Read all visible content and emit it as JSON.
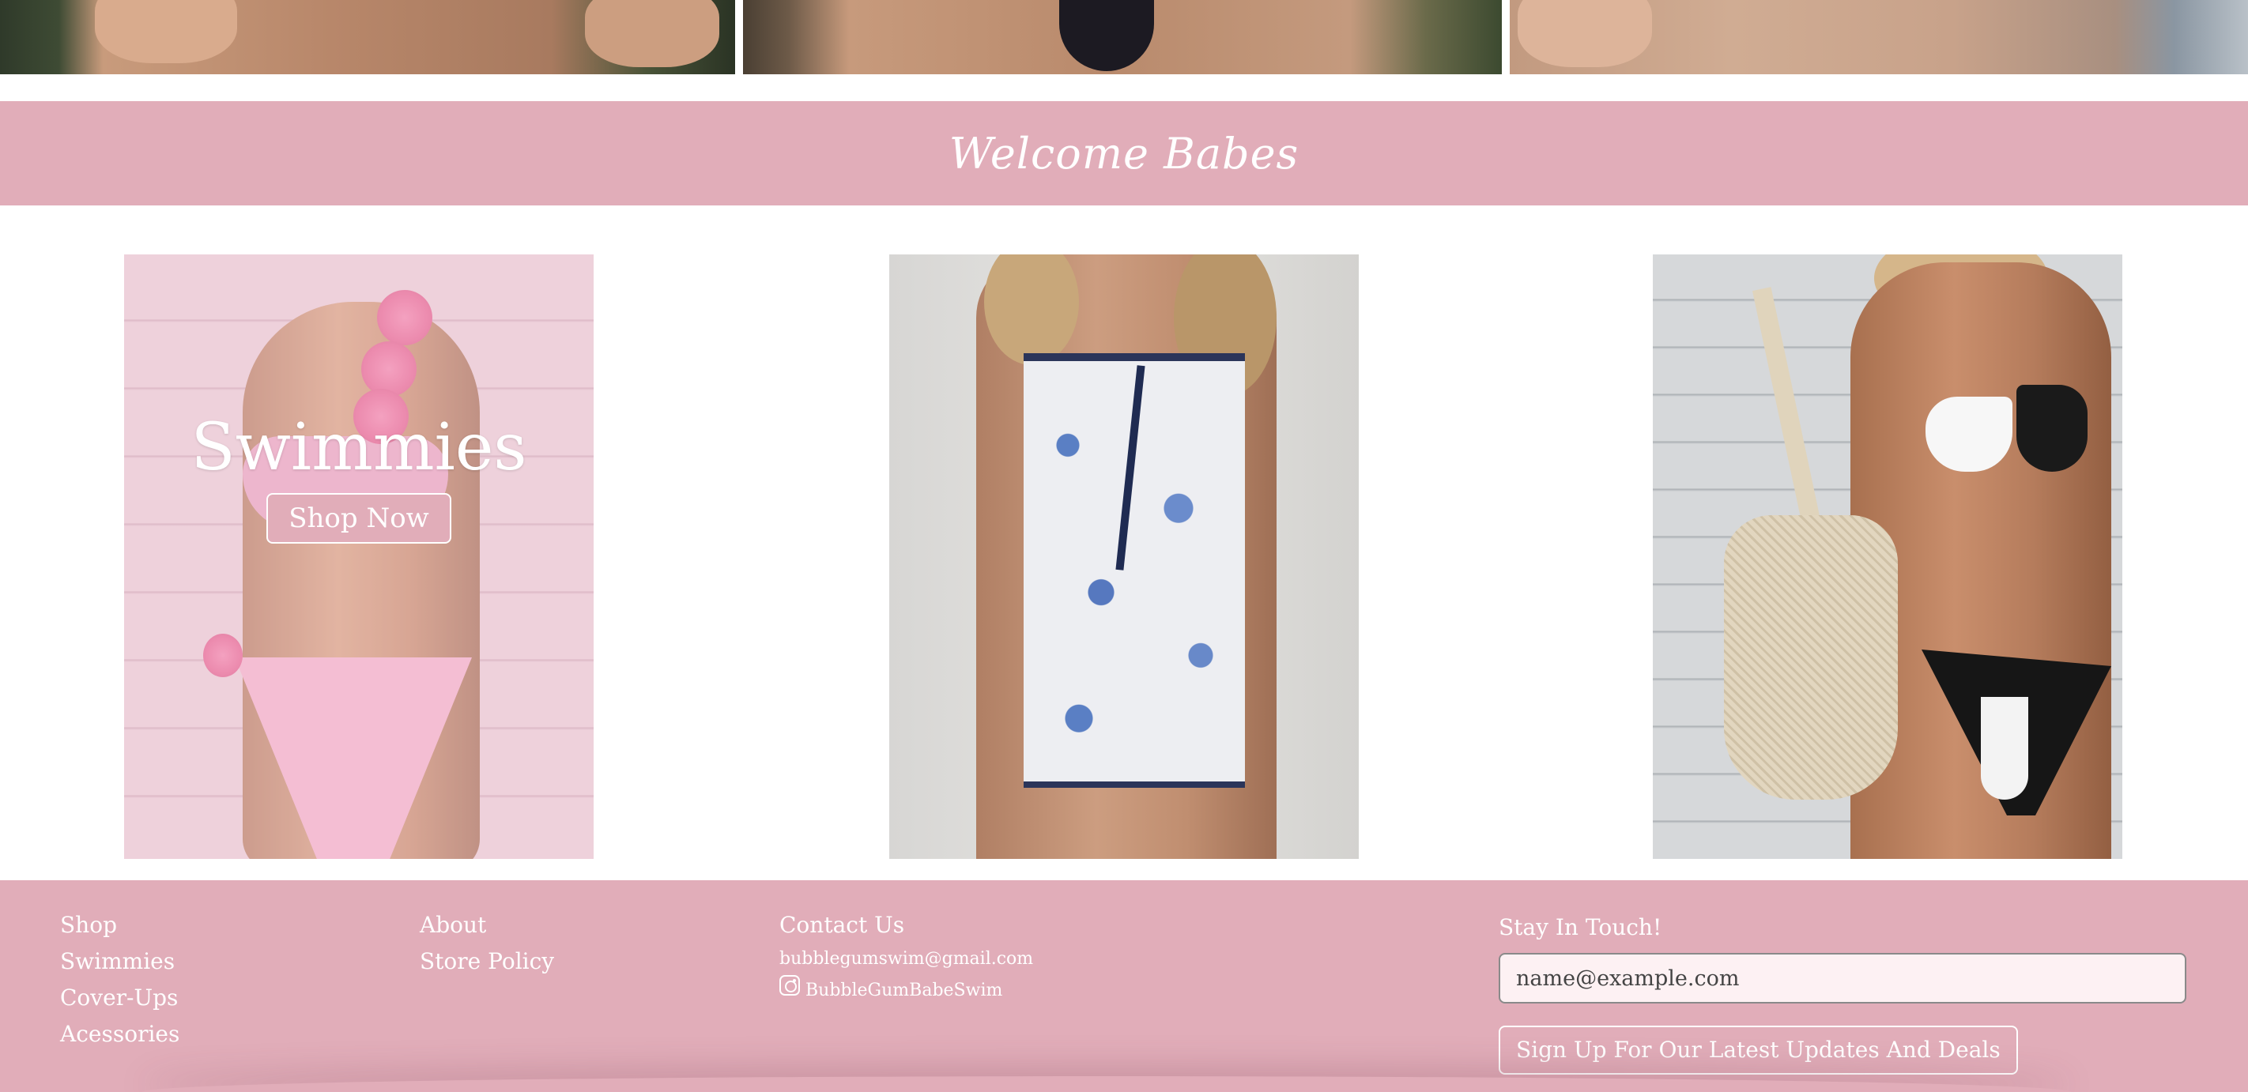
{
  "banner": {
    "welcome": "Welcome Babes"
  },
  "cards": [
    {
      "title": "Swimmies",
      "button": "Shop Now"
    },
    {
      "title": "",
      "button": ""
    },
    {
      "title": "",
      "button": ""
    }
  ],
  "footer": {
    "shop_column": [
      "Shop",
      "Swimmies",
      "Cover-Ups",
      "Acessories"
    ],
    "about_column": [
      "About",
      "Store Policy"
    ],
    "contact": {
      "title": "Contact Us",
      "email": "bubblegumswim@gmail.com",
      "instagram_icon": "instagram-icon",
      "instagram": "BubbleGumBabeSwim"
    },
    "newsletter": {
      "title": "Stay In Touch!",
      "placeholder": "name@example.com",
      "button": "Sign Up For Our Latest Updates And Deals"
    }
  },
  "colors": {
    "brand_pink": "#e1adb9",
    "text_on_pink": "#ffffff",
    "input_bg": "#fdf1f3"
  }
}
